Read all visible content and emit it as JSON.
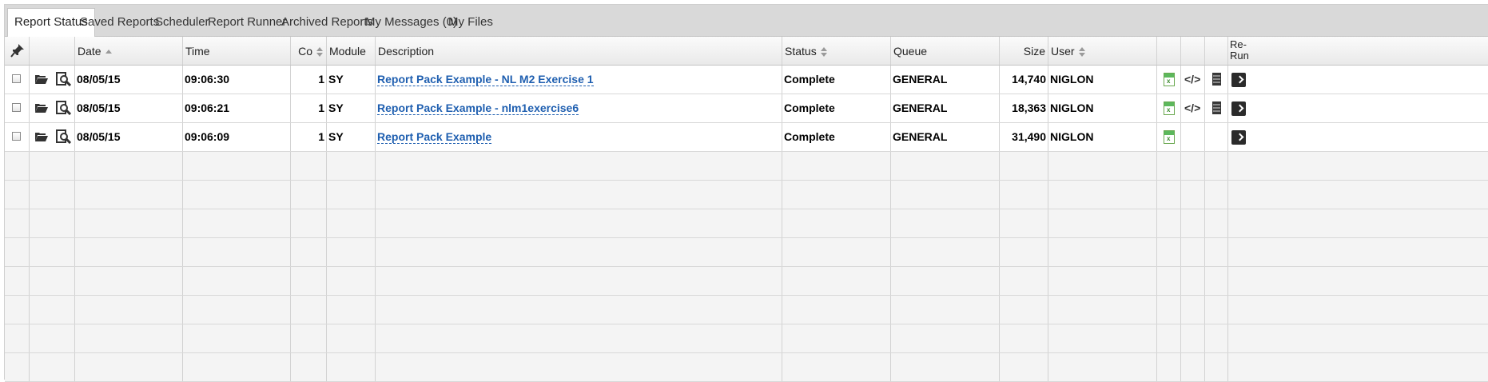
{
  "tabs": [
    {
      "label": "Report Status"
    },
    {
      "label": "Saved Reports"
    },
    {
      "label": "Scheduler"
    },
    {
      "label": "Report Runner"
    },
    {
      "label": "Archived Reports"
    },
    {
      "label": "My Messages (0)"
    },
    {
      "label": "My Files"
    }
  ],
  "columns": {
    "date": "Date",
    "time": "Time",
    "co": "Co",
    "module": "Module",
    "description": "Description",
    "status": "Status",
    "queue": "Queue",
    "size": "Size",
    "user": "User",
    "rerun_line1": "Re-",
    "rerun_line2": "Run"
  },
  "rows": [
    {
      "date": "08/05/15",
      "time": "09:06:30",
      "co": "1",
      "module": "SY",
      "description": "Report Pack Example - NL M2 Exercise 1",
      "status": "Complete",
      "queue": "GENERAL",
      "size": "14,740",
      "user": "NIGLON"
    },
    {
      "date": "08/05/15",
      "time": "09:06:21",
      "co": "1",
      "module": "SY",
      "description": "Report Pack Example - nlm1exercise6",
      "status": "Complete",
      "queue": "GENERAL",
      "size": "18,363",
      "user": "NIGLON"
    },
    {
      "date": "08/05/15",
      "time": "09:06:09",
      "co": "1",
      "module": "SY",
      "description": "Report Pack Example",
      "status": "Complete",
      "queue": "GENERAL",
      "size": "31,490",
      "user": "NIGLON"
    }
  ],
  "icons": {
    "pin": "pin-icon",
    "folder": "folder-open-icon",
    "view": "magnifier-report-icon",
    "excel": "excel-icon",
    "code": "code-icon",
    "document": "document-icon",
    "rerun": "play-arrow-icon"
  },
  "colors": {
    "link": "#1f5fb0",
    "tabbar": "#d9d9d9",
    "empty_row": "#f4f4f4"
  }
}
